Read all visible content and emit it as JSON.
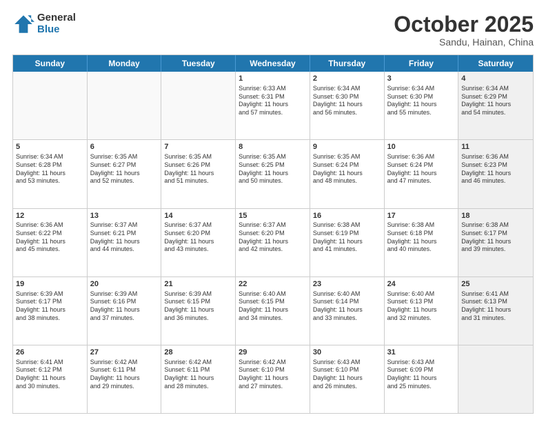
{
  "header": {
    "logo_general": "General",
    "logo_blue": "Blue",
    "month_year": "October 2025",
    "location": "Sandu, Hainan, China"
  },
  "days_of_week": [
    "Sunday",
    "Monday",
    "Tuesday",
    "Wednesday",
    "Thursday",
    "Friday",
    "Saturday"
  ],
  "weeks": [
    [
      {
        "day": "",
        "info": "",
        "empty": true
      },
      {
        "day": "",
        "info": "",
        "empty": true
      },
      {
        "day": "",
        "info": "",
        "empty": true
      },
      {
        "day": "1",
        "info": "Sunrise: 6:33 AM\nSunset: 6:31 PM\nDaylight: 11 hours\nand 57 minutes."
      },
      {
        "day": "2",
        "info": "Sunrise: 6:34 AM\nSunset: 6:30 PM\nDaylight: 11 hours\nand 56 minutes."
      },
      {
        "day": "3",
        "info": "Sunrise: 6:34 AM\nSunset: 6:30 PM\nDaylight: 11 hours\nand 55 minutes."
      },
      {
        "day": "4",
        "info": "Sunrise: 6:34 AM\nSunset: 6:29 PM\nDaylight: 11 hours\nand 54 minutes.",
        "shaded": true
      }
    ],
    [
      {
        "day": "5",
        "info": "Sunrise: 6:34 AM\nSunset: 6:28 PM\nDaylight: 11 hours\nand 53 minutes."
      },
      {
        "day": "6",
        "info": "Sunrise: 6:35 AM\nSunset: 6:27 PM\nDaylight: 11 hours\nand 52 minutes."
      },
      {
        "day": "7",
        "info": "Sunrise: 6:35 AM\nSunset: 6:26 PM\nDaylight: 11 hours\nand 51 minutes."
      },
      {
        "day": "8",
        "info": "Sunrise: 6:35 AM\nSunset: 6:25 PM\nDaylight: 11 hours\nand 50 minutes."
      },
      {
        "day": "9",
        "info": "Sunrise: 6:35 AM\nSunset: 6:24 PM\nDaylight: 11 hours\nand 48 minutes."
      },
      {
        "day": "10",
        "info": "Sunrise: 6:36 AM\nSunset: 6:24 PM\nDaylight: 11 hours\nand 47 minutes."
      },
      {
        "day": "11",
        "info": "Sunrise: 6:36 AM\nSunset: 6:23 PM\nDaylight: 11 hours\nand 46 minutes.",
        "shaded": true
      }
    ],
    [
      {
        "day": "12",
        "info": "Sunrise: 6:36 AM\nSunset: 6:22 PM\nDaylight: 11 hours\nand 45 minutes."
      },
      {
        "day": "13",
        "info": "Sunrise: 6:37 AM\nSunset: 6:21 PM\nDaylight: 11 hours\nand 44 minutes."
      },
      {
        "day": "14",
        "info": "Sunrise: 6:37 AM\nSunset: 6:20 PM\nDaylight: 11 hours\nand 43 minutes."
      },
      {
        "day": "15",
        "info": "Sunrise: 6:37 AM\nSunset: 6:20 PM\nDaylight: 11 hours\nand 42 minutes."
      },
      {
        "day": "16",
        "info": "Sunrise: 6:38 AM\nSunset: 6:19 PM\nDaylight: 11 hours\nand 41 minutes."
      },
      {
        "day": "17",
        "info": "Sunrise: 6:38 AM\nSunset: 6:18 PM\nDaylight: 11 hours\nand 40 minutes."
      },
      {
        "day": "18",
        "info": "Sunrise: 6:38 AM\nSunset: 6:17 PM\nDaylight: 11 hours\nand 39 minutes.",
        "shaded": true
      }
    ],
    [
      {
        "day": "19",
        "info": "Sunrise: 6:39 AM\nSunset: 6:17 PM\nDaylight: 11 hours\nand 38 minutes."
      },
      {
        "day": "20",
        "info": "Sunrise: 6:39 AM\nSunset: 6:16 PM\nDaylight: 11 hours\nand 37 minutes."
      },
      {
        "day": "21",
        "info": "Sunrise: 6:39 AM\nSunset: 6:15 PM\nDaylight: 11 hours\nand 36 minutes."
      },
      {
        "day": "22",
        "info": "Sunrise: 6:40 AM\nSunset: 6:15 PM\nDaylight: 11 hours\nand 34 minutes."
      },
      {
        "day": "23",
        "info": "Sunrise: 6:40 AM\nSunset: 6:14 PM\nDaylight: 11 hours\nand 33 minutes."
      },
      {
        "day": "24",
        "info": "Sunrise: 6:40 AM\nSunset: 6:13 PM\nDaylight: 11 hours\nand 32 minutes."
      },
      {
        "day": "25",
        "info": "Sunrise: 6:41 AM\nSunset: 6:13 PM\nDaylight: 11 hours\nand 31 minutes.",
        "shaded": true
      }
    ],
    [
      {
        "day": "26",
        "info": "Sunrise: 6:41 AM\nSunset: 6:12 PM\nDaylight: 11 hours\nand 30 minutes."
      },
      {
        "day": "27",
        "info": "Sunrise: 6:42 AM\nSunset: 6:11 PM\nDaylight: 11 hours\nand 29 minutes."
      },
      {
        "day": "28",
        "info": "Sunrise: 6:42 AM\nSunset: 6:11 PM\nDaylight: 11 hours\nand 28 minutes."
      },
      {
        "day": "29",
        "info": "Sunrise: 6:42 AM\nSunset: 6:10 PM\nDaylight: 11 hours\nand 27 minutes."
      },
      {
        "day": "30",
        "info": "Sunrise: 6:43 AM\nSunset: 6:10 PM\nDaylight: 11 hours\nand 26 minutes."
      },
      {
        "day": "31",
        "info": "Sunrise: 6:43 AM\nSunset: 6:09 PM\nDaylight: 11 hours\nand 25 minutes."
      },
      {
        "day": "",
        "info": "",
        "empty": true,
        "shaded": true
      }
    ]
  ]
}
